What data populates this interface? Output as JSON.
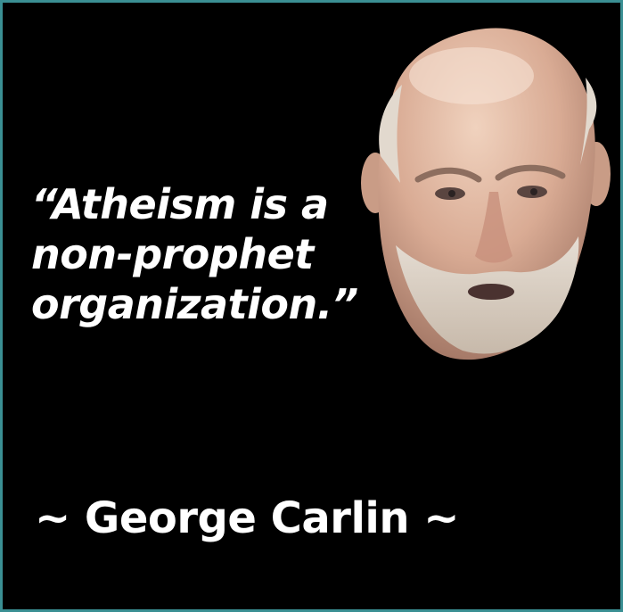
{
  "quote": {
    "lines": [
      "“Atheism is a",
      "non-prophet",
      "organization.”"
    ]
  },
  "attribution": "~ George Carlin ~",
  "portrait": {
    "icon": "portrait-icon"
  },
  "colors": {
    "background": "#000000",
    "border": "#3a8f93",
    "text": "#ffffff"
  }
}
